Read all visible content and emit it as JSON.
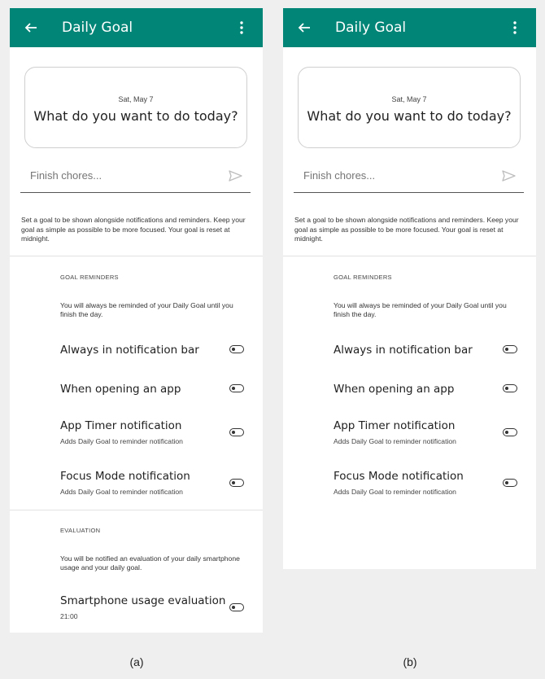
{
  "appbar": {
    "title": "Daily Goal",
    "back_icon": "arrow-left-icon",
    "menu_icon": "more-vert-icon"
  },
  "goal_card": {
    "date": "Sat, May 7",
    "question": "What do you want to do today?"
  },
  "goal_input": {
    "placeholder": "Finish chores...",
    "send_icon": "send-icon"
  },
  "goal_description": "Set a goal to be shown alongside notifications and reminders. Keep your goal as simple as possible to be more focused. Your goal is reset at midnight.",
  "goal_reminders": {
    "header": "GOAL REMINDERS",
    "description": "You will always be reminded of your Daily Goal until you finish the day.",
    "items": [
      {
        "title": "Always in notification bar",
        "subtitle": "",
        "enabled": false
      },
      {
        "title": "When opening an app",
        "subtitle": "",
        "enabled": false
      },
      {
        "title": "App Timer notification",
        "subtitle": "Adds Daily Goal to reminder notification",
        "enabled": false
      },
      {
        "title": "Focus Mode notification",
        "subtitle": "Adds Daily Goal to reminder notification",
        "enabled": false
      }
    ]
  },
  "evaluation": {
    "header": "EVALUATION",
    "description": "You will be notified an evaluation of your daily smartphone usage and your daily goal.",
    "items": [
      {
        "title": "Smartphone usage evaluation",
        "subtitle": "21:00",
        "enabled": false
      }
    ]
  },
  "captions": {
    "a": "(a)",
    "b": "(b)"
  },
  "colors": {
    "appbar": "#008577",
    "background": "#efefef",
    "screen": "#ffffff"
  }
}
